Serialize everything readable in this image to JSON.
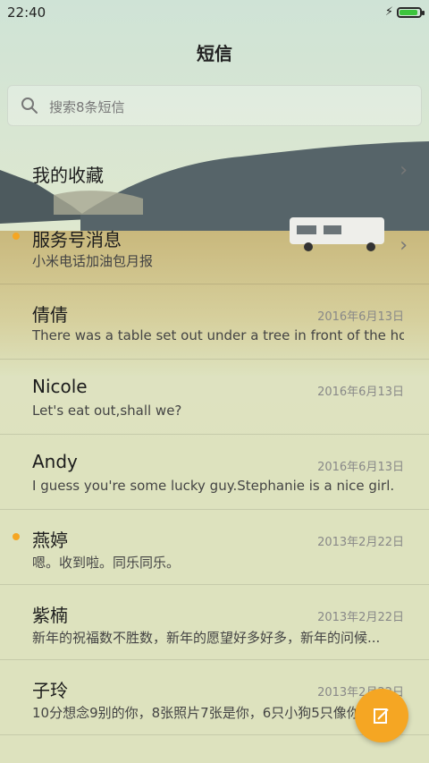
{
  "status_bar": {
    "time": "22:40",
    "battery_level": 1.0,
    "charging": true
  },
  "header": {
    "title": "短信"
  },
  "search": {
    "placeholder": "搜索8条短信"
  },
  "favorites": {
    "label": "我的收藏"
  },
  "service": {
    "name": "服务号消息",
    "preview": "小米电话加油包月报",
    "unread": true
  },
  "conversations": [
    {
      "name": "倩倩",
      "date": "2016年6月13日",
      "preview": "There was a table set out under a tree in front of the ho...",
      "unread": false
    },
    {
      "name": "Nicole",
      "date": "2016年6月13日",
      "preview": "Let's eat out,shall we?",
      "unread": false
    },
    {
      "name": "Andy",
      "date": "2016年6月13日",
      "preview": "I guess you're some lucky guy.Stephanie is a nice girl.",
      "unread": false
    },
    {
      "name": "燕婷",
      "date": "2013年2月22日",
      "preview": "嗯。收到啦。同乐同乐。",
      "unread": true
    },
    {
      "name": "紫楠",
      "date": "2013年2月22日",
      "preview": "新年的祝福数不胜数，新年的愿望好多好多，新年的问候...",
      "unread": false
    },
    {
      "name": "子玲",
      "date": "2013年2月22日",
      "preview": "10分想念9别的你，8张照片7张是你，6只小狗5只像你...",
      "unread": false
    }
  ],
  "colors": {
    "accent": "#f5a623",
    "battery": "#3cc53c",
    "background": "#dde2be"
  },
  "icons": {
    "search": "search-icon",
    "compose": "compose-icon",
    "chevron": "chevron-right-icon",
    "charging": "lightning-icon"
  }
}
